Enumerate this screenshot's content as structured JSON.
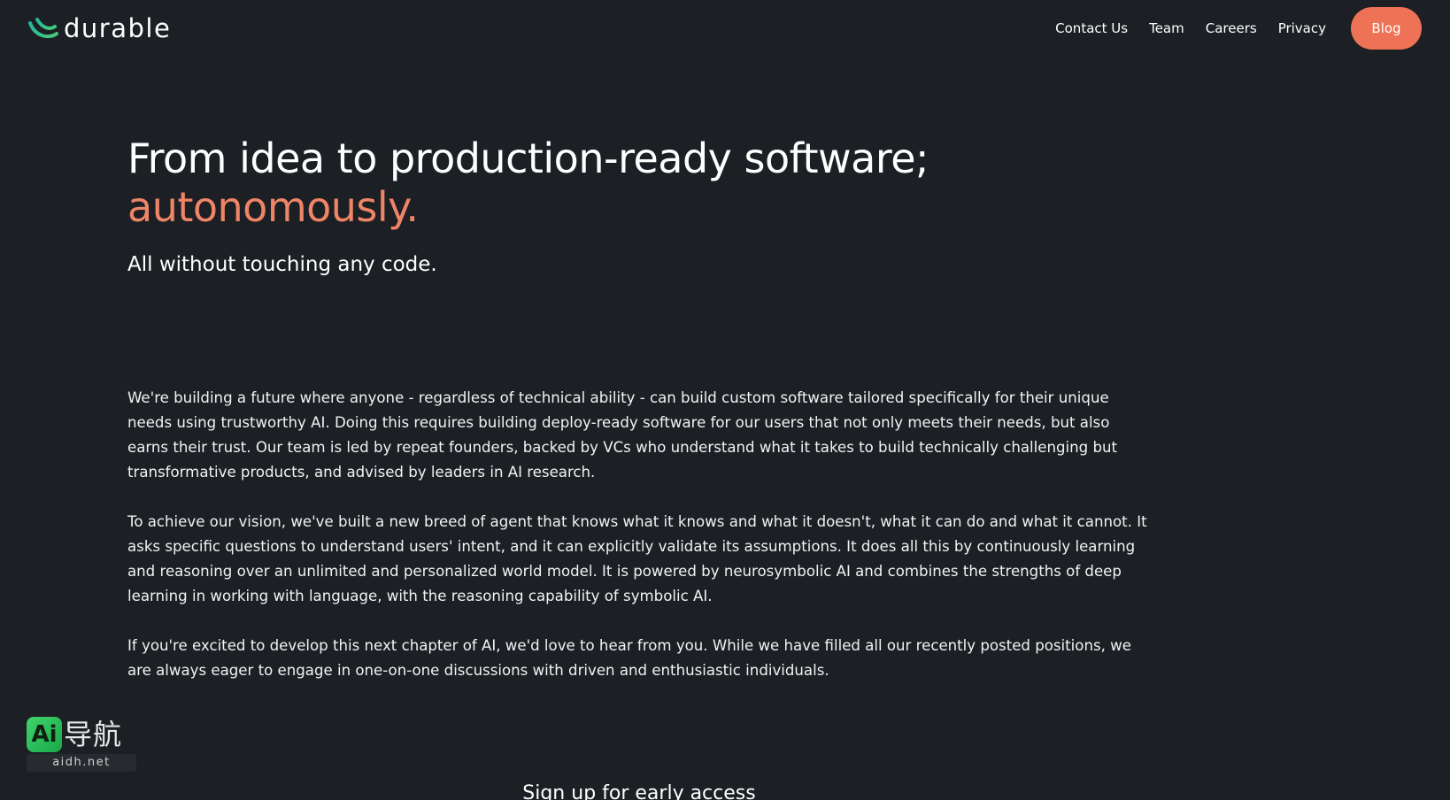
{
  "brand": {
    "name": "durable",
    "logo_icon": "durable-leaf-icon",
    "colors": {
      "background": "#1c1f24",
      "accent": "#ee7255",
      "logo_gradient": [
        "#1fb8a0",
        "#45c97a"
      ]
    }
  },
  "nav": {
    "links": [
      {
        "label": "Contact Us"
      },
      {
        "label": "Team"
      },
      {
        "label": "Careers"
      },
      {
        "label": "Privacy"
      }
    ],
    "cta_label": "Blog"
  },
  "hero": {
    "title_line1": "From idea to production-ready software;",
    "title_accent": "autonomously.",
    "subtitle": "All without touching any code."
  },
  "body": {
    "paragraphs": [
      "We're building a future where anyone - regardless of technical ability - can build custom software tailored specifically for their unique needs using trustworthy AI. Doing this requires building deploy-ready software for our users that not only meets their needs, but also earns their trust. Our team is led by repeat founders, backed by VCs who understand what it takes to build technically challenging but transformative products, and advised by leaders in AI research.",
      "To achieve our vision, we've built a new breed of agent that knows what it knows and what it doesn't, what it can do and what it cannot. It asks specific questions to understand users' intent, and it can explicitly validate its assumptions. It does all this by continuously learning and reasoning over an unlimited and personalized world model. It is powered by neurosymbolic AI and combines the strengths of deep learning in working with language, with the reasoning capability of symbolic AI.",
      "If you're excited to develop this next chapter of AI, we'd love to hear from you. While we have filled all our recently posted positions, we are always eager to engage in one-on-one discussions with driven and enthusiastic individuals."
    ]
  },
  "signup": {
    "heading": "Sign up for early access"
  },
  "watermark": {
    "badge": "Ai",
    "text_cn": "导航",
    "url": "aidh.net"
  }
}
